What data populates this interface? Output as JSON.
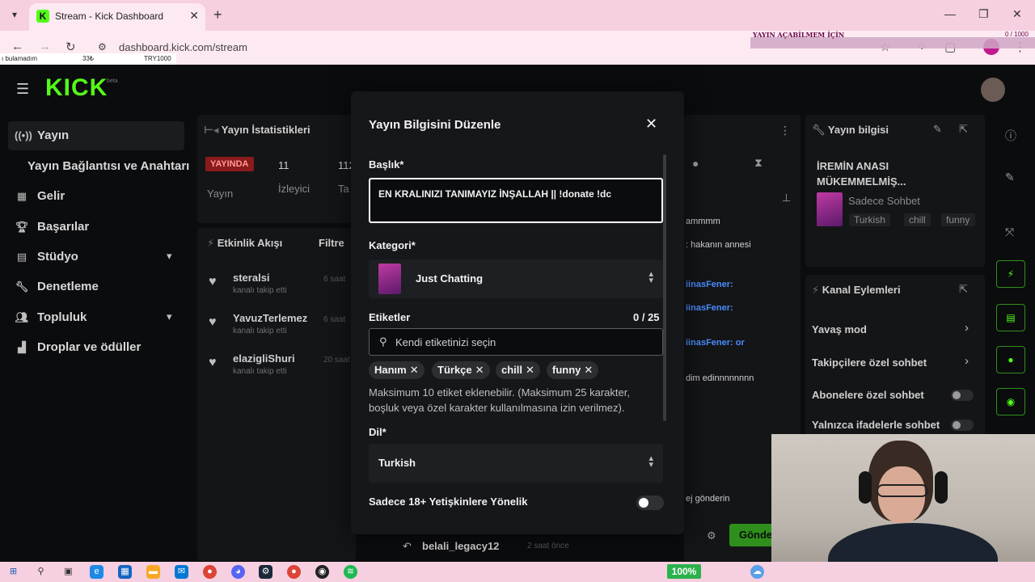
{
  "browser": {
    "tab_title": "Stream - Kick Dashboard",
    "url": "dashboard.kick.com/stream",
    "overlay_text": "YAYIN AÇABİLMEM İÇİN",
    "overlay_count": "0 / 1000",
    "ticker": [
      "ı bulamadım",
      "33₺",
      "TRY1000"
    ]
  },
  "logo": {
    "text": "KICK",
    "beta": "beta"
  },
  "sidebar": {
    "items": [
      {
        "label": "Yayın",
        "icon": "broadcast-icon"
      },
      {
        "label": "Yayın Bağlantısı ve Anahtarı",
        "icon": ""
      },
      {
        "label": "Gelir",
        "icon": "revenue-icon"
      },
      {
        "label": "Başarılar",
        "icon": "trophy-icon"
      },
      {
        "label": "Stüdyo",
        "icon": "studio-icon"
      },
      {
        "label": "Denetleme",
        "icon": "wrench-icon"
      },
      {
        "label": "Topluluk",
        "icon": "community-icon"
      },
      {
        "label": "Droplar ve ödüller",
        "icon": "gift-icon"
      }
    ]
  },
  "stats": {
    "title": "Yayın İstatistikleri",
    "live_badge": "YAYINDA",
    "viewers": "11",
    "followers": "112",
    "label_stream": "Yayın",
    "label_viewers": "İzleyici",
    "label_third": "Ta"
  },
  "activity": {
    "title": "Etkinlik Akışı",
    "filter": "Filtre",
    "items": [
      {
        "name": "steralsi",
        "sub": "kanalı takip etti",
        "time": "6 saat"
      },
      {
        "name": "YavuzTerlemez",
        "sub": "kanalı takip etti",
        "time": "6 saat"
      },
      {
        "name": "elazigliShuri",
        "sub": "kanalı takip etti",
        "time": "20 saat"
      }
    ],
    "bottom_name": "belali_legacy12",
    "bottom_time": "2 saat önce"
  },
  "chat": {
    "lines": [
      "ammmm",
      ": hakanın annesi",
      "iinasFener:",
      "iinasFener:",
      "iinasFener: or",
      "dim edinnnnnnnn"
    ],
    "input_placeholder": "ej gönderin",
    "send": "Gönder"
  },
  "stream_info": {
    "title": "Yayın bilgisi",
    "stream_title": "İREMİN ANASI MÜKEMMELMİŞ...",
    "category": "Sadece Sohbet",
    "tags": [
      "Turkish",
      "chill",
      "funny"
    ]
  },
  "channel_actions": {
    "title": "Kanal Eylemleri",
    "items": [
      "Yavaş mod",
      "Takipçilere özel sohbet",
      "Abonelere özel sohbet",
      "Yalnızca ifadelerle sohbet"
    ]
  },
  "modal": {
    "title": "Yayın Bilgisini Düzenle",
    "title_label": "Başlık*",
    "title_value": "EN KRALINIZI TANIMAYIZ İNŞALLAH || !donate !dc",
    "category_label": "Kategori*",
    "category_value": "Just Chatting",
    "tags_label": "Etiketler",
    "tags_count": "0 / 25",
    "tags_placeholder": "Kendi etiketinizi seçin",
    "tags": [
      "Hanım",
      "Türkçe",
      "chill",
      "funny"
    ],
    "hint": "Maksimum 10 etiket eklenebilir. (Maksimum 25 karakter, boşluk veya özel karakter kullanılmasına izin verilmez).",
    "language_label": "Dil*",
    "language_value": "Turkish",
    "adult_label": "Sadece 18+ Yetişkinlere Yönelik",
    "adult_enabled": false
  },
  "taskbar": {
    "battery": "100%"
  },
  "colors": {
    "accent": "#53fc18",
    "tabbar": "#f6cfe0",
    "bg": "#0b0c0e"
  }
}
